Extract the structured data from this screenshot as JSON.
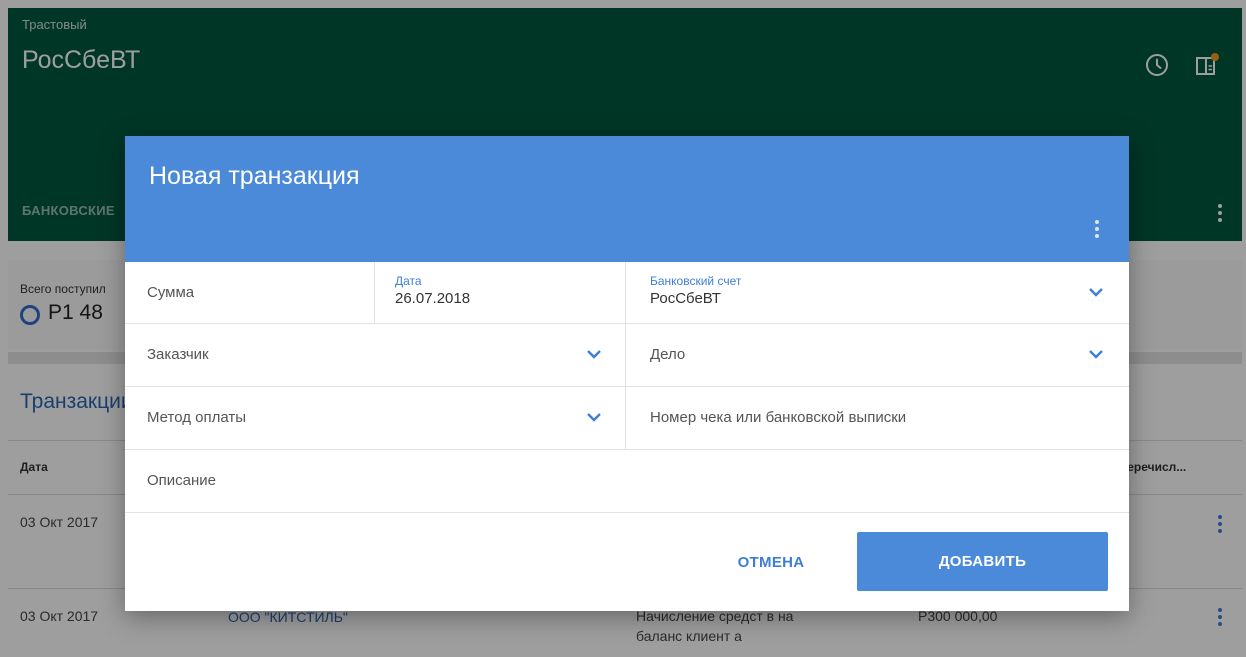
{
  "header": {
    "subtitle": "Трастовый",
    "title": "РосСбеВТ",
    "tab_label": "БАНКОВСКИЕ"
  },
  "summary": {
    "label": "Всего поступил",
    "value": "P1 48"
  },
  "transactions": {
    "title": "Транзакции",
    "columns": {
      "date": "Дата",
      "transfer": "перечисл..."
    },
    "rows": [
      {
        "date": "03 Окт 2017"
      },
      {
        "date": "03 Окт 2017",
        "client": "ООО \"КИТСТИЛЬ\"",
        "description": "Начисление средст в на баланс клиент а",
        "amount": "P300 000,00"
      }
    ]
  },
  "dialog": {
    "title": "Новая транзакция",
    "fields": {
      "amount_placeholder": "Сумма",
      "date_label": "Дата",
      "date_value": "26.07.2018",
      "account_label": "Банковский счет",
      "account_value": "РосСбеВТ",
      "customer_placeholder": "Заказчик",
      "case_placeholder": "Дело",
      "payment_method_placeholder": "Метод оплаты",
      "receipt_placeholder": "Номер чека или банковской выписки",
      "description_placeholder": "Описание"
    },
    "cancel_label": "ОТМЕНА",
    "add_label": "ДОБАВИТЬ"
  },
  "colors": {
    "header_green": "#00573e",
    "dialog_blue": "#4a8ad9",
    "accent_blue": "#3e7fd6"
  },
  "icons": [
    "clock-icon",
    "side-panel-icon",
    "more-vert-icon",
    "chevron-down-icon"
  ]
}
